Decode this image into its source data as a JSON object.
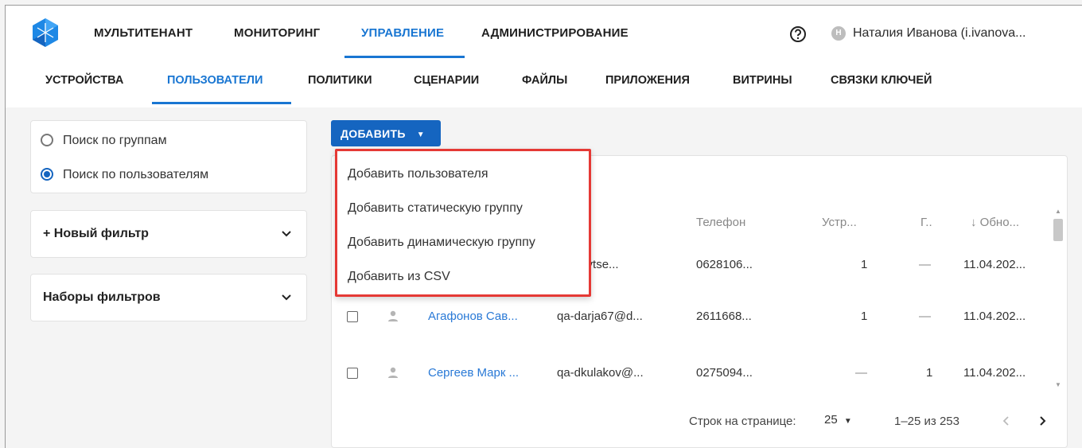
{
  "header": {
    "nav": [
      {
        "label": "МУЛЬТИТЕНАНТ",
        "active": false
      },
      {
        "label": "МОНИТОРИНГ",
        "active": false
      },
      {
        "label": "УПРАВЛЕНИЕ",
        "active": true
      },
      {
        "label": "АДМИНИСТРИРОВАНИЕ",
        "active": false
      }
    ],
    "avatar_initial": "Н",
    "user_name": "Наталия Иванова (i.ivanova...",
    "accent_color": "#1976d2"
  },
  "subnav": {
    "items": [
      {
        "label": "УСТРОЙСТВА"
      },
      {
        "label": "ПОЛЬЗОВАТЕЛИ",
        "active": true
      },
      {
        "label": "ПОЛИТИКИ"
      },
      {
        "label": "СЦЕНАРИИ"
      },
      {
        "label": "ФАЙЛЫ"
      },
      {
        "label": "ПРИЛОЖЕНИЯ"
      },
      {
        "label": "ВИТРИНЫ"
      },
      {
        "label": "СВЯЗКИ КЛЮЧЕЙ"
      }
    ]
  },
  "sidebar": {
    "search_options": [
      {
        "label": "Поиск по группам",
        "selected": false
      },
      {
        "label": "Поиск по пользователям",
        "selected": true
      }
    ],
    "new_filter": "+ Новый фильтр",
    "filter_sets": "Наборы фильтров"
  },
  "toolbar": {
    "add_label": "ДОБАВИТЬ"
  },
  "add_menu": {
    "items": [
      "Добавить пользователя",
      "Добавить статическую группу",
      "Добавить динамическую группу",
      "Добавить из CSV"
    ],
    "highlight_color": "#e53935"
  },
  "table": {
    "headers": {
      "phone": "Телефон",
      "devices": "Устр...",
      "groups": "Г..",
      "updated": "Обно..."
    },
    "rows": [
      {
        "name": "",
        "email": ":udrjavtse...",
        "phone": "0628106...",
        "devices": "1",
        "groups": "—",
        "updated": "11.04.202..."
      },
      {
        "name": "Агафонов Сав...",
        "email": "qa-darja67@d...",
        "phone": "2611668...",
        "devices": "1",
        "groups": "—",
        "updated": "11.04.202..."
      },
      {
        "name": "Сергеев Марк ...",
        "email": "qa-dkulakov@...",
        "phone": "0275094...",
        "devices": "—",
        "groups": "1",
        "updated": "11.04.202..."
      }
    ]
  },
  "pagination": {
    "rows_per_page_label": "Строк на странице:",
    "rows_per_page_value": "25",
    "range": "1–25 из 253"
  }
}
